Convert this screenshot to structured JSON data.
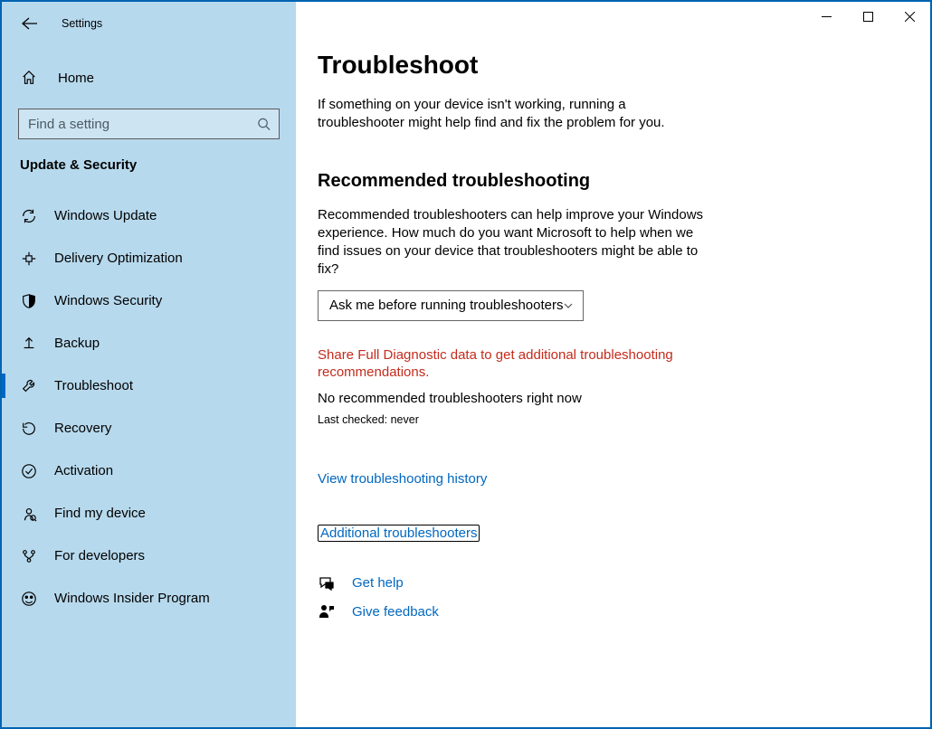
{
  "window": {
    "title": "Settings"
  },
  "sidebar": {
    "home": "Home",
    "search_placeholder": "Find a setting",
    "section": "Update & Security",
    "items": [
      {
        "icon": "sync",
        "label": "Windows Update"
      },
      {
        "icon": "delivery",
        "label": "Delivery Optimization"
      },
      {
        "icon": "shield",
        "label": "Windows Security"
      },
      {
        "icon": "backup",
        "label": "Backup"
      },
      {
        "icon": "wrench",
        "label": "Troubleshoot"
      },
      {
        "icon": "recovery",
        "label": "Recovery"
      },
      {
        "icon": "check-circle",
        "label": "Activation"
      },
      {
        "icon": "find-device",
        "label": "Find my device"
      },
      {
        "icon": "dev",
        "label": "For developers"
      },
      {
        "icon": "insider",
        "label": "Windows Insider Program"
      }
    ],
    "active_index": 4
  },
  "content": {
    "title": "Troubleshoot",
    "intro": "If something on your device isn't working, running a troubleshooter might help find and fix the problem for you.",
    "recommended_heading": "Recommended troubleshooting",
    "recommended_desc": "Recommended troubleshooters can help improve your Windows experience. How much do you want Microsoft to help when we find issues on your device that troubleshooters might be able to fix?",
    "dropdown_value": "Ask me before running troubleshooters",
    "warning": "Share Full Diagnostic data to get additional troubleshooting recommendations.",
    "status": "No recommended troubleshooters right now",
    "last_checked": "Last checked: never",
    "history_link": "View troubleshooting history",
    "additional_link": "Additional troubleshooters",
    "get_help": "Get help",
    "give_feedback": "Give feedback"
  }
}
